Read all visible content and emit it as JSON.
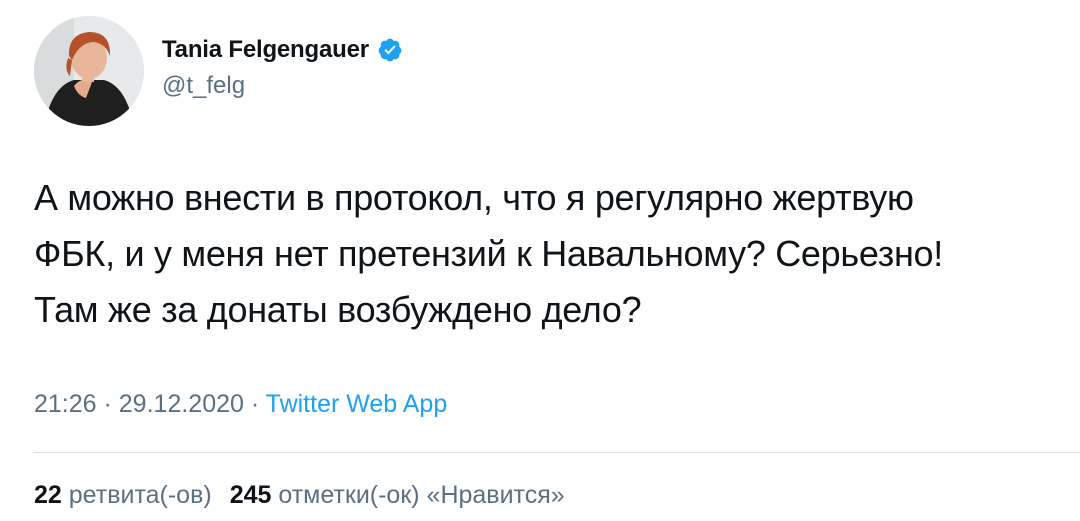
{
  "author": {
    "display_name": "Tania Felgengauer",
    "handle": "@t_felg",
    "verified_icon": "verified-badge-icon",
    "verified_color": "#1da1f2"
  },
  "tweet": {
    "lines": [
      "А можно внести в протокол, что я регулярно жертвую",
      "ФБК, и у меня нет претензий к Навальному? Серьезно!",
      "Там же за донаты возбуждено дело?"
    ]
  },
  "meta": {
    "time": "21:26",
    "separator": " · ",
    "date": "29.12.2020",
    "source": "Twitter Web App"
  },
  "stats": {
    "retweets_count": "22",
    "retweets_label": "ретвита(-ов)",
    "likes_count": "245",
    "likes_label": "отметки(-ок) «Нравится»"
  },
  "colors": {
    "text": "#0f1419",
    "secondary": "#5b7083",
    "link": "#1da1f2"
  }
}
